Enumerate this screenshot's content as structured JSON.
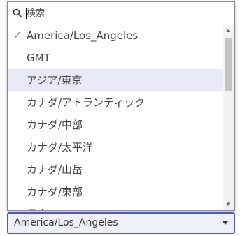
{
  "search": {
    "placeholder": "検索",
    "value": ""
  },
  "timezone_list": {
    "items": [
      {
        "label": "America/Los_Angeles",
        "checked": true
      },
      {
        "label": "GMT"
      },
      {
        "label": "アジア/東京",
        "highlighted": true
      },
      {
        "label": "カナダ/アトランティック"
      },
      {
        "label": "カナダ/中部"
      },
      {
        "label": "カナダ/太平洋"
      },
      {
        "label": "カナダ/山岳"
      },
      {
        "label": "カナダ/東部"
      },
      {
        "label": "日本"
      }
    ],
    "check_glyph": "✓"
  },
  "selector": {
    "selected": "America/Los_Angeles"
  },
  "colors": {
    "accent": "#4a57c6",
    "highlight": "#e8e8f6",
    "check": "#4a7fa0"
  },
  "icons": [
    "search-icon",
    "checkmark-icon",
    "scroll-up-arrow-icon",
    "scroll-down-arrow-icon",
    "chevron-down-icon"
  ]
}
